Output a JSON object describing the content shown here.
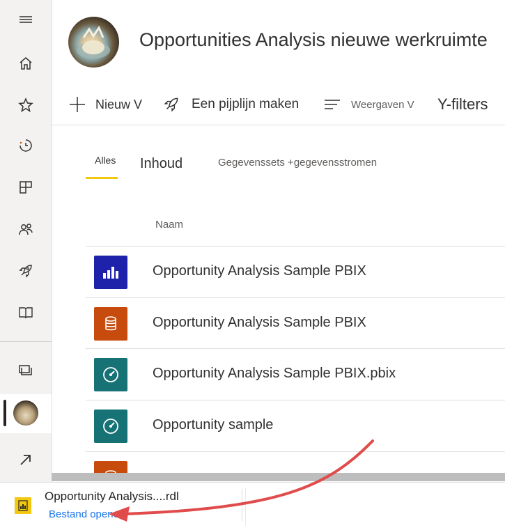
{
  "workspace": {
    "title": "Opportunities Analysis nieuwe werkruimte"
  },
  "sidebar": {
    "items": [
      {
        "name": "menu-icon"
      },
      {
        "name": "home-icon"
      },
      {
        "name": "star-icon"
      },
      {
        "name": "recent-icon"
      },
      {
        "name": "apps-icon"
      },
      {
        "name": "shared-icon"
      },
      {
        "name": "rocket-icon"
      },
      {
        "name": "learn-icon"
      },
      {
        "name": "workspaces-icon"
      },
      {
        "name": "popout-icon"
      }
    ]
  },
  "toolbar": {
    "new_label": "Nieuw V",
    "pipeline_label": "Een pijplijn maken",
    "views_label": "Weergaven V",
    "filters_label": "Y-filters"
  },
  "tabs": {
    "all": "Alles",
    "content": "Inhoud",
    "datasets": "Gegevenssets +gegevensstromen"
  },
  "table": {
    "column_name": "Naam",
    "rows": [
      {
        "label": "Opportunity Analysis Sample PBIX",
        "icon": "report-icon",
        "color": "#1e22aa"
      },
      {
        "label": "Opportunity Analysis Sample PBIX",
        "icon": "dataset-icon",
        "color": "#c84b0e"
      },
      {
        "label": "Opportunity Analysis Sample PBIX.pbix",
        "icon": "dashboard-icon",
        "color": "#167275"
      },
      {
        "label": "Opportunity sample",
        "icon": "dashboard-icon",
        "color": "#167275"
      },
      {
        "label": "",
        "icon": "dataset-icon",
        "color": "#c84b0e"
      }
    ]
  },
  "download": {
    "file_name": "Opportunity Analysis....rdl",
    "action": "Bestand openen",
    "more": "..."
  },
  "colors": {
    "accent": "#f2c811",
    "arrow": "#e04b4b",
    "link": "#1a73e8"
  }
}
